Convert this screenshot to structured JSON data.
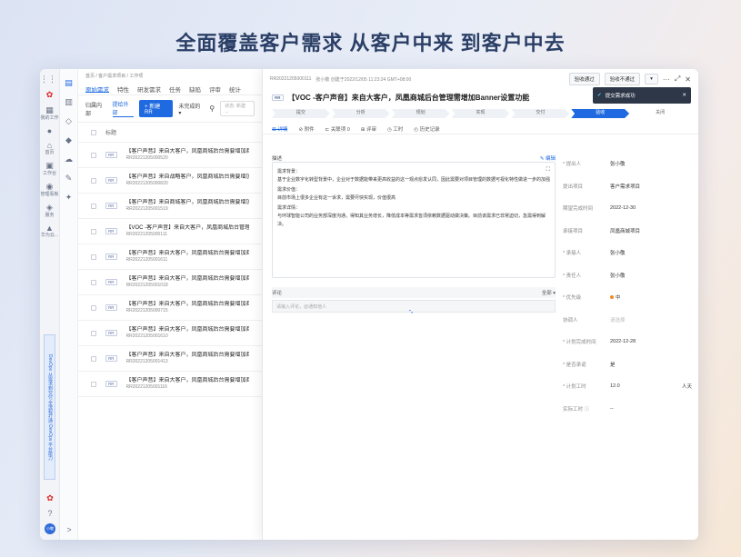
{
  "hero_title": "全面覆盖客户需求 从客户中来 到客户中去",
  "rail1": {
    "items": [
      {
        "icon": "grid-icon",
        "glyph": "⋮⋮⋮",
        "label": ""
      },
      {
        "icon": "huawei-logo-icon",
        "glyph": "✿",
        "label": ""
      },
      {
        "icon": "dashboard-icon",
        "glyph": "▦",
        "label": "我的工作"
      },
      {
        "icon": "location-icon",
        "glyph": "●",
        "label": ""
      },
      {
        "icon": "home-icon",
        "glyph": "⌂",
        "label": "首页"
      },
      {
        "icon": "workbench-icon",
        "glyph": "▣",
        "label": "工作台"
      },
      {
        "icon": "management-icon",
        "glyph": "◉",
        "label": "管理看板"
      },
      {
        "icon": "service-icon",
        "glyph": "◈",
        "label": "服务"
      },
      {
        "icon": "partner-icon",
        "glyph": "▲",
        "label": "华为云..."
      }
    ],
    "vertical_banner": "DevOps 从需求到交付 全流程打通 DevOps 平台能力",
    "bottom_items": [
      {
        "icon": "huawei-small-icon",
        "glyph": "✿"
      },
      {
        "icon": "help-icon",
        "glyph": "?"
      },
      {
        "icon": "user-avatar-icon",
        "glyph": "小敬"
      }
    ]
  },
  "rail2": {
    "icons": [
      {
        "icon": "project-icon",
        "glyph": "▤"
      },
      {
        "icon": "doc-icon",
        "glyph": "▥"
      },
      {
        "icon": "code-icon",
        "glyph": "◇"
      },
      {
        "icon": "build-icon",
        "glyph": "◆"
      },
      {
        "icon": "deploy-icon",
        "glyph": "☁"
      },
      {
        "icon": "test-icon",
        "glyph": "✎"
      },
      {
        "icon": "more-icon",
        "glyph": "✦"
      }
    ],
    "expand_glyph": ">"
  },
  "list": {
    "breadcrumb": "首页 / 客户需求项目 / 工作项",
    "tabs": [
      {
        "label": "原始需求",
        "active": true
      },
      {
        "label": "特性",
        "active": false
      },
      {
        "label": "研发需求",
        "active": false
      },
      {
        "label": "任务",
        "active": false
      },
      {
        "label": "缺陷",
        "active": false
      },
      {
        "label": "评审",
        "active": false
      },
      {
        "label": "统计",
        "active": false
      }
    ],
    "toolbar": {
      "scope_internal": "归属内部",
      "scope_external": "提给外部",
      "new_button": "+ 新建RR",
      "filter": "未完成的 ▾",
      "search_placeholder": "状态: 新建 ..."
    },
    "header_title": "标题",
    "rows": [
      {
        "tag": "RR",
        "title": "【客户声音】来自大客户，凤凰商城后台需要增加商品",
        "id": "RR20221205000520"
      },
      {
        "tag": "RR",
        "title": "【客户声音】来自战略客户，凤凰商城后台需要增加商品",
        "id": "RR20221205000820"
      },
      {
        "tag": "RR",
        "title": "【客户声音】来自商城客户，凤凰商城后台需要增加商品",
        "id": "RR20221205001519"
      },
      {
        "tag": "RR",
        "title": "【VOC -客户声音】来自大客户，凤凰商城后台管理需增加",
        "id": "RR20221205000111"
      },
      {
        "tag": "RR",
        "title": "【客户声音】来自大客户，凤凰商城后台需要增加商品",
        "id": "RR20221205001611"
      },
      {
        "tag": "RR",
        "title": "【客户声音】来自大客户，凤凰商城后台需要增加商品",
        "id": "RR20221205001018"
      },
      {
        "tag": "RR",
        "title": "【客户声音】来自大客户，凤凰商城后台需要增加商品",
        "id": "RR20221205000715"
      },
      {
        "tag": "RR",
        "title": "【客户声音】来自大客户，凤凰商城后台需要增加商品",
        "id": "RR20221205001610"
      },
      {
        "tag": "RR",
        "title": "【客户声音】来自大客户，凤凰商城后台需要增加商品",
        "id": "RR20221205001413"
      },
      {
        "tag": "RR",
        "title": "【客户声音】来自大客户，凤凰商城后台需要增加商品",
        "id": "RR20221205001116"
      }
    ]
  },
  "panel": {
    "id": "RR20221205000111",
    "meta": "张小敬 创建于2022/12/05 11:23:24 GMT+08:00",
    "btn_pass": "验收通过",
    "btn_fail": "验收不通过",
    "btn_more": "▾",
    "ctrl_more": "···",
    "ctrl_expand": "⤢",
    "ctrl_close": "✕",
    "toast": "提交需求成功",
    "toast_close": "✕",
    "tag": "RR",
    "title": "【VOC -客户声音】来自大客户，凤凰商城后台管理需增加Banner设置功能",
    "stages": [
      {
        "label": "提交",
        "active": false
      },
      {
        "label": "分析",
        "active": false
      },
      {
        "label": "规划",
        "active": false
      },
      {
        "label": "实现",
        "active": false
      },
      {
        "label": "交付",
        "active": false
      },
      {
        "label": "验收",
        "active": true
      },
      {
        "label": "关闭",
        "active": false
      }
    ],
    "tabs": [
      {
        "label": "☰ 详情",
        "active": true
      },
      {
        "label": "⊘ 附件",
        "active": false
      },
      {
        "label": "⊏ 关联项 0",
        "active": false
      },
      {
        "label": "⊞ 评审",
        "active": false
      },
      {
        "label": "◷ 工时",
        "active": false
      },
      {
        "label": "◴ 历史记录",
        "active": false
      }
    ],
    "desc_label": "描述",
    "desc_edit": "✎ 编辑",
    "desc_lines": [
      "需求背景：",
      "基于企业数字化转型背景中，企业对于数据能带来更高收益的这一观点愈发认同，因此需要对项目管理的数据可视化特性做进一步的加强",
      "需求价值：",
      "目前市场上很多企业有这一诉求，需要尽快实现，价值很高",
      "需求详情：",
      "与环球智能公司的业务部深度沟通，得知其业务增长，降低成本等需求皆须依赖数据驱动做决策。目前该需求已非常迫切，急需得到解决。"
    ],
    "comment_label": "评论",
    "comment_filter": "全部 ▾",
    "comment_placeholder": "请输入评论，@通知他人",
    "spinner": "⠢",
    "props": [
      {
        "label": "* 提出人",
        "value": "张小敬",
        "ph": false
      },
      {
        "label": "提出项目",
        "value": "客户需求项目",
        "ph": false
      },
      {
        "label": "期望完成时间",
        "value": "2022-12-30",
        "ph": false
      },
      {
        "label": "承接项目",
        "value": "凤凰商城项目",
        "ph": false
      },
      {
        "label": "* 承接人",
        "value": "张小敬",
        "ph": false
      },
      {
        "label": "* 责任人",
        "value": "张小敬",
        "ph": false
      },
      {
        "label": "* 优先级",
        "value": "中",
        "ph": false,
        "dot": true
      },
      {
        "label": "协调人",
        "value": "请选择",
        "ph": true
      },
      {
        "label": "* 计划完成时间",
        "value": "2022-12-28",
        "ph": false
      },
      {
        "label": "* 是否承诺",
        "value": "是",
        "ph": false
      },
      {
        "label": "* 计划工时",
        "value": "12.0",
        "ph": false,
        "unit": "人天"
      },
      {
        "label": "实际工时 ⓘ",
        "value": "--",
        "ph": false
      }
    ],
    "colors": {
      "accent": "#1f6ae0",
      "priority": "#f08a24"
    }
  }
}
